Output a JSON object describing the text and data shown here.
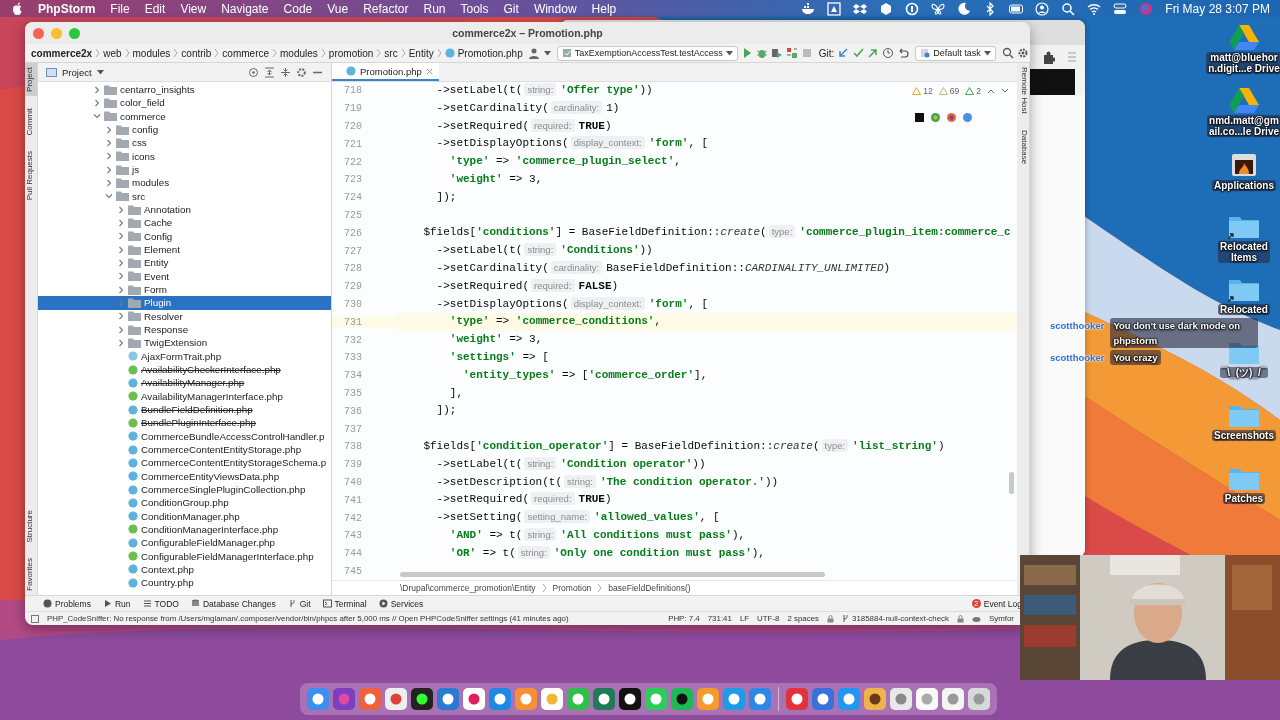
{
  "menubar": {
    "app": "PhpStorm",
    "menus": [
      "File",
      "Edit",
      "View",
      "Navigate",
      "Code",
      "Vue",
      "Refactor",
      "Run",
      "Tools",
      "Git",
      "Window",
      "Help"
    ],
    "clock": "Fri May 28  3:07 PM"
  },
  "window": {
    "title": "commerce2x – Promotion.php",
    "breadcrumbs": [
      "commerce2x",
      "web",
      "modules",
      "contrib",
      "commerce",
      "modules",
      "promotion",
      "src",
      "Entity",
      "Promotion.php"
    ],
    "run_config": "TaxExemptionAccessTest.testAccess",
    "git_label": "Git:",
    "task": "Default task"
  },
  "left_tool_tabs": {
    "top": [
      {
        "label": "Project",
        "selected": true
      },
      {
        "label": "Commit",
        "selected": false
      },
      {
        "label": "Pull Requests",
        "selected": false
      }
    ],
    "bottom": [
      {
        "label": "Structure",
        "selected": false
      },
      {
        "label": "Favorites",
        "selected": false
      }
    ]
  },
  "project_panel": {
    "title": "Project",
    "tree": [
      {
        "label": "centarro_insights",
        "kind": "folder",
        "expanded": false,
        "selected": false
      },
      {
        "label": "color_field",
        "kind": "folder",
        "expanded": false,
        "selected": false
      },
      {
        "label": "commerce",
        "kind": "folder",
        "expanded": true,
        "selected": false,
        "children": [
          {
            "label": "config",
            "kind": "folder",
            "expanded": false,
            "selected": false
          },
          {
            "label": "css",
            "kind": "folder",
            "expanded": false,
            "selected": false
          },
          {
            "label": "icons",
            "kind": "folder",
            "expanded": false,
            "selected": false
          },
          {
            "label": "js",
            "kind": "folder",
            "expanded": false,
            "selected": false
          },
          {
            "label": "modules",
            "kind": "folder",
            "expanded": false,
            "selected": false
          },
          {
            "label": "src",
            "kind": "folder",
            "expanded": true,
            "selected": false,
            "children": [
              {
                "label": "Annotation",
                "kind": "folder",
                "expanded": false,
                "selected": false
              },
              {
                "label": "Cache",
                "kind": "folder",
                "expanded": false,
                "selected": false
              },
              {
                "label": "Config",
                "kind": "folder",
                "expanded": false,
                "selected": false
              },
              {
                "label": "Element",
                "kind": "folder",
                "expanded": false,
                "selected": false
              },
              {
                "label": "Entity",
                "kind": "folder",
                "expanded": false,
                "selected": false
              },
              {
                "label": "Event",
                "kind": "folder",
                "expanded": false,
                "selected": false
              },
              {
                "label": "Form",
                "kind": "folder",
                "expanded": false,
                "selected": false
              },
              {
                "label": "Plugin",
                "kind": "folder",
                "expanded": false,
                "selected": true
              },
              {
                "label": "Resolver",
                "kind": "folder",
                "expanded": false,
                "selected": false
              },
              {
                "label": "Response",
                "kind": "folder",
                "expanded": false,
                "selected": false
              },
              {
                "label": "TwigExtension",
                "kind": "folder",
                "expanded": false,
                "selected": false
              },
              {
                "label": "AjaxFormTrait.php",
                "kind": "trait",
                "deprecated": false,
                "selected": false
              },
              {
                "label": "AvailabilityCheckerInterface.php",
                "kind": "interface",
                "deprecated": true,
                "selected": false
              },
              {
                "label": "AvailabilityManager.php",
                "kind": "class",
                "deprecated": true,
                "selected": false
              },
              {
                "label": "AvailabilityManagerInterface.php",
                "kind": "interface",
                "deprecated": false,
                "selected": false
              },
              {
                "label": "BundleFieldDefinition.php",
                "kind": "class",
                "deprecated": true,
                "selected": false
              },
              {
                "label": "BundlePluginInterface.php",
                "kind": "interface",
                "deprecated": true,
                "selected": false
              },
              {
                "label": "CommerceBundleAccessControlHandler.p",
                "kind": "class",
                "deprecated": false,
                "selected": false
              },
              {
                "label": "CommerceContentEntityStorage.php",
                "kind": "class",
                "deprecated": false,
                "selected": false
              },
              {
                "label": "CommerceContentEntityStorageSchema.p",
                "kind": "class",
                "deprecated": false,
                "selected": false
              },
              {
                "label": "CommerceEntityViewsData.php",
                "kind": "class",
                "deprecated": false,
                "selected": false
              },
              {
                "label": "CommerceSinglePluginCollection.php",
                "kind": "class",
                "deprecated": false,
                "selected": false
              },
              {
                "label": "ConditionGroup.php",
                "kind": "class",
                "deprecated": false,
                "selected": false
              },
              {
                "label": "ConditionManager.php",
                "kind": "class",
                "deprecated": false,
                "selected": false
              },
              {
                "label": "ConditionManagerInterface.php",
                "kind": "interface",
                "deprecated": false,
                "selected": false
              },
              {
                "label": "ConfigurableFieldManager.php",
                "kind": "class",
                "deprecated": false,
                "selected": false
              },
              {
                "label": "ConfigurableFieldManagerInterface.php",
                "kind": "interface",
                "deprecated": false,
                "selected": false
              },
              {
                "label": "Context.php",
                "kind": "class",
                "deprecated": false,
                "selected": false
              },
              {
                "label": "Country.php",
                "kind": "class",
                "deprecated": false,
                "selected": false
              }
            ]
          }
        ]
      }
    ]
  },
  "editor": {
    "tab": "Promotion.php",
    "inspections": {
      "warnings": "12",
      "weak_warnings": "69",
      "typos": "2"
    },
    "lines": [
      {
        "number": "718",
        "current": false,
        "tokens": [
          {
            "kind": "code",
            "text": "      ->setLabel(t("
          },
          {
            "kind": "hint",
            "text": "string:"
          },
          {
            "kind": "string",
            "text": "'Offer type'"
          },
          {
            "kind": "code",
            "text": "))"
          }
        ]
      },
      {
        "number": "719",
        "current": false,
        "tokens": [
          {
            "kind": "code",
            "text": "      ->setCardinality("
          },
          {
            "kind": "hint",
            "text": "cardinality:"
          },
          {
            "kind": "code",
            "text": "1)"
          }
        ]
      },
      {
        "number": "720",
        "current": false,
        "tokens": [
          {
            "kind": "code",
            "text": "      ->setRequired("
          },
          {
            "kind": "hint",
            "text": "required:"
          },
          {
            "kind": "keyword",
            "text": "TRUE"
          },
          {
            "kind": "code",
            "text": ")"
          }
        ]
      },
      {
        "number": "721",
        "current": false,
        "tokens": [
          {
            "kind": "code",
            "text": "      ->setDisplayOptions("
          },
          {
            "kind": "hint",
            "text": "display_context:"
          },
          {
            "kind": "string",
            "text": "'form'"
          },
          {
            "kind": "code",
            "text": ", ["
          }
        ]
      },
      {
        "number": "722",
        "current": false,
        "tokens": [
          {
            "kind": "string",
            "text": "        'type'"
          },
          {
            "kind": "code",
            "text": " => "
          },
          {
            "kind": "string",
            "text": "'commerce_plugin_select'"
          },
          {
            "kind": "code",
            "text": ","
          }
        ]
      },
      {
        "number": "723",
        "current": false,
        "tokens": [
          {
            "kind": "string",
            "text": "        'weight'"
          },
          {
            "kind": "code",
            "text": " => 3,"
          }
        ]
      },
      {
        "number": "724",
        "current": false,
        "tokens": [
          {
            "kind": "code",
            "text": "      ]);"
          }
        ]
      },
      {
        "number": "725",
        "current": false
      },
      {
        "number": "726",
        "current": false,
        "tokens": [
          {
            "kind": "code",
            "text": "    $fields["
          },
          {
            "kind": "string",
            "text": "'conditions'"
          },
          {
            "kind": "code",
            "text": "] = BaseFieldDefinition::"
          },
          {
            "kind": "italic",
            "text": "create"
          },
          {
            "kind": "code",
            "text": "("
          },
          {
            "kind": "hint",
            "text": "type:"
          },
          {
            "kind": "string",
            "text": "'commerce_plugin_item:commerce_c"
          }
        ]
      },
      {
        "number": "727",
        "current": false,
        "tokens": [
          {
            "kind": "code",
            "text": "      ->setLabel(t("
          },
          {
            "kind": "hint",
            "text": "string:"
          },
          {
            "kind": "string",
            "text": "'Conditions'"
          },
          {
            "kind": "code",
            "text": "))"
          }
        ]
      },
      {
        "number": "728",
        "current": false,
        "tokens": [
          {
            "kind": "code",
            "text": "      ->setCardinality("
          },
          {
            "kind": "hint",
            "text": "cardinality:"
          },
          {
            "kind": "code",
            "text": "BaseFieldDefinition::"
          },
          {
            "kind": "italic",
            "text": "CARDINALITY_UNLIMITED"
          },
          {
            "kind": "code",
            "text": ")"
          }
        ]
      },
      {
        "number": "729",
        "current": false,
        "tokens": [
          {
            "kind": "code",
            "text": "      ->setRequired("
          },
          {
            "kind": "hint",
            "text": "required:"
          },
          {
            "kind": "keyword",
            "text": "FALSE"
          },
          {
            "kind": "code",
            "text": ")"
          }
        ]
      },
      {
        "number": "730",
        "current": false,
        "tokens": [
          {
            "kind": "code",
            "text": "      ->setDisplayOptions("
          },
          {
            "kind": "hint",
            "text": "display_context:"
          },
          {
            "kind": "string",
            "text": "'form'"
          },
          {
            "kind": "code",
            "text": ", ["
          }
        ]
      },
      {
        "number": "731",
        "current": true,
        "tokens": [
          {
            "kind": "string",
            "text": "        'type'"
          },
          {
            "kind": "code",
            "text": " => "
          },
          {
            "kind": "string",
            "text": "'commerce_conditions'"
          },
          {
            "kind": "code",
            "text": ","
          }
        ]
      },
      {
        "number": "732",
        "current": false,
        "tokens": [
          {
            "kind": "string",
            "text": "        'weight'"
          },
          {
            "kind": "code",
            "text": " => 3,"
          }
        ]
      },
      {
        "number": "733",
        "current": false,
        "tokens": [
          {
            "kind": "string",
            "text": "        'settings'"
          },
          {
            "kind": "code",
            "text": " => ["
          }
        ]
      },
      {
        "number": "734",
        "current": false,
        "tokens": [
          {
            "kind": "string",
            "text": "          'entity_types'"
          },
          {
            "kind": "code",
            "text": " => ["
          },
          {
            "kind": "string",
            "text": "'commerce_order'"
          },
          {
            "kind": "code",
            "text": "],"
          }
        ]
      },
      {
        "number": "735",
        "current": false,
        "tokens": [
          {
            "kind": "code",
            "text": "        ],"
          }
        ]
      },
      {
        "number": "736",
        "current": false,
        "tokens": [
          {
            "kind": "code",
            "text": "      ]);"
          }
        ]
      },
      {
        "number": "737",
        "current": false
      },
      {
        "number": "738",
        "current": false,
        "tokens": [
          {
            "kind": "code",
            "text": "    $fields["
          },
          {
            "kind": "string",
            "text": "'condition_operator'"
          },
          {
            "kind": "code",
            "text": "] = BaseFieldDefinition::"
          },
          {
            "kind": "italic",
            "text": "create"
          },
          {
            "kind": "code",
            "text": "("
          },
          {
            "kind": "hint",
            "text": "type:"
          },
          {
            "kind": "string",
            "text": "'list_string'"
          },
          {
            "kind": "code",
            "text": ")"
          }
        ]
      },
      {
        "number": "739",
        "current": false,
        "tokens": [
          {
            "kind": "code",
            "text": "      ->setLabel(t("
          },
          {
            "kind": "hint",
            "text": "string:"
          },
          {
            "kind": "string",
            "text": "'Condition operator'"
          },
          {
            "kind": "code",
            "text": "))"
          }
        ]
      },
      {
        "number": "740",
        "current": false,
        "tokens": [
          {
            "kind": "code",
            "text": "      ->setDescription(t("
          },
          {
            "kind": "hint",
            "text": "string:"
          },
          {
            "kind": "string",
            "text": "'The condition operator.'"
          },
          {
            "kind": "code",
            "text": "))"
          }
        ]
      },
      {
        "number": "741",
        "current": false,
        "tokens": [
          {
            "kind": "code",
            "text": "      ->setRequired("
          },
          {
            "kind": "hint",
            "text": "required:"
          },
          {
            "kind": "keyword",
            "text": "TRUE"
          },
          {
            "kind": "code",
            "text": ")"
          }
        ]
      },
      {
        "number": "742",
        "current": false,
        "tokens": [
          {
            "kind": "code",
            "text": "      ->setSetting("
          },
          {
            "kind": "hint",
            "text": "setting_name:"
          },
          {
            "kind": "string",
            "text": "'allowed_values'"
          },
          {
            "kind": "code",
            "text": ", ["
          }
        ]
      },
      {
        "number": "743",
        "current": false,
        "tokens": [
          {
            "kind": "string",
            "text": "        'AND'"
          },
          {
            "kind": "code",
            "text": " => t("
          },
          {
            "kind": "hint",
            "text": "string:"
          },
          {
            "kind": "string",
            "text": "'All conditions must pass'"
          },
          {
            "kind": "code",
            "text": "),"
          }
        ]
      },
      {
        "number": "744",
        "current": false,
        "tokens": [
          {
            "kind": "string",
            "text": "        'OR'"
          },
          {
            "kind": "code",
            "text": " => t("
          },
          {
            "kind": "hint",
            "text": "string:"
          },
          {
            "kind": "string",
            "text": "'Only one condition must pass'"
          },
          {
            "kind": "code",
            "text": "),"
          }
        ]
      },
      {
        "number": "745",
        "current": false
      }
    ],
    "breadcrumbs": [
      "\\Drupal\\commerce_promotion\\Entity",
      "Promotion",
      "baseFieldDefinitions()"
    ]
  },
  "right_tool_tabs": [
    "Remote Host",
    "Database"
  ],
  "tool_tabs": [
    "Problems",
    "Run",
    "TODO",
    "Database Changes",
    "Git",
    "Terminal",
    "Services"
  ],
  "event_log": {
    "label": "Event Log",
    "count": "2"
  },
  "status_bar": {
    "message": "PHP_CodeSniffer: No response from /Users/mglaman/.composer/vendor/bin/phpcs after 5,000 ms // Open PHPCodeSniffer settings (41 minutes ago)",
    "php": "PHP: 7.4",
    "position": "731:41",
    "line_ending": "LF",
    "encoding": "UTF-8",
    "indent": "2 spaces",
    "branch": "3185884-null-context-check",
    "framework": "Symfor"
  },
  "desktop_icons": [
    {
      "kind": "drive",
      "label_lines": [
        "matt@bluehor",
        "n.digit...e Drive"
      ]
    },
    {
      "kind": "drive",
      "label_lines": [
        "nmd.matt@gm",
        "ail.co...le Drive"
      ]
    },
    {
      "kind": "apps",
      "label_lines": [
        "Applications"
      ]
    },
    {
      "kind": "alias",
      "label_lines": [
        "Relocated",
        "Items"
      ]
    },
    {
      "kind": "alias",
      "label_lines": [
        "Relocated"
      ]
    },
    {
      "kind": "folder",
      "label_lines": [
        "¯\\_(ツ)_/¯"
      ]
    },
    {
      "kind": "folder",
      "label_lines": [
        "Screenshots"
      ]
    },
    {
      "kind": "folder",
      "label_lines": [
        "Patches"
      ]
    }
  ],
  "chat": [
    {
      "user": "scotthooker",
      "message": "You don't use dark mode on phpstorm"
    },
    {
      "user": "scotthooker",
      "message": "You crazy"
    }
  ]
}
